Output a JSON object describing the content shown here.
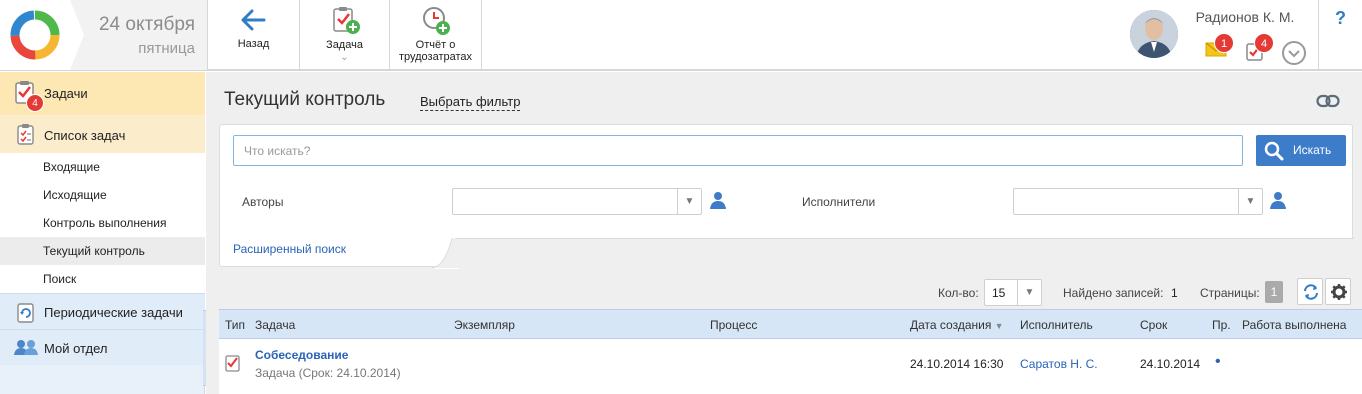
{
  "header": {
    "date": "24 октября",
    "weekday": "пятница",
    "toolbar": {
      "back_label": "Назад",
      "task_label": "Задача",
      "report_label_line1": "Отчёт о",
      "report_label_line2": "трудозатратах"
    },
    "user_name": "Радионов К. М.",
    "mail_badge": "1",
    "tasks_badge": "4",
    "help_label": "?"
  },
  "sidebar": {
    "tasks_label": "Задачи",
    "tasks_badge": "4",
    "task_list_label": "Список задач",
    "sub_items": [
      "Входящие",
      "Исходящие",
      "Контроль выполнения",
      "Текущий контроль",
      "Поиск"
    ],
    "periodic_label": "Периодические задачи",
    "department_label": "Мой отдел"
  },
  "main": {
    "title": "Текущий контроль",
    "filter_link": "Выбрать фильтр",
    "search": {
      "placeholder": "Что искать?",
      "button_label": "Искать",
      "authors_label": "Авторы",
      "executors_label": "Исполнители",
      "advanced_link": "Расширенный поиск"
    },
    "pager": {
      "count_label": "Кол-во:",
      "count_value": "15",
      "found_label": "Найдено записей:",
      "found_value": "1",
      "pages_label": "Страницы:",
      "page_value": "1"
    },
    "table": {
      "columns": [
        "Тип",
        "Задача",
        "Экземпляр",
        "Процесс",
        "Дата создания",
        "Исполнитель",
        "Срок",
        "Пр.",
        "Работа выполнена"
      ],
      "rows": [
        {
          "task_title": "Собеседование",
          "task_subtitle": "Задача (Срок: 24.10.2014)",
          "instance": "",
          "process": "",
          "created": "24.10.2014 16:30",
          "executor": "Саратов Н. С.",
          "deadline": "24.10.2014",
          "priority": "•",
          "done": ""
        }
      ]
    }
  },
  "colors": {
    "accent_blue": "#3d7cc9",
    "link_blue": "#2a63b8",
    "sidebar_active": "#fde7b2",
    "badge_red": "#e53935"
  }
}
